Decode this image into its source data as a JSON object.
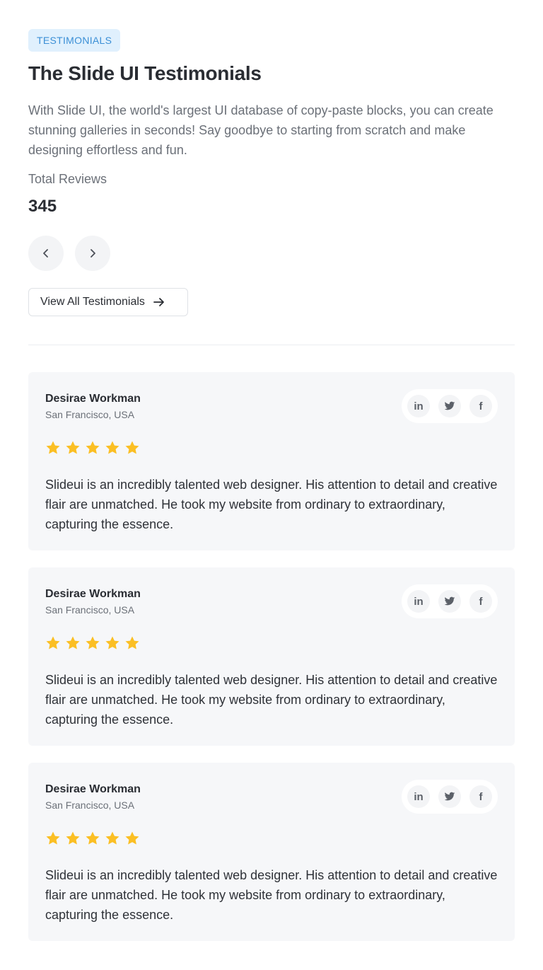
{
  "header": {
    "badge": "TESTIMONIALS",
    "title": "The Slide UI Testimonials",
    "description": "With Slide UI, the world's largest UI database of copy-paste blocks, you can create stunning galleries in seconds! Say goodbye to starting from scratch and make designing effortless and fun.",
    "reviews_label": "Total Reviews",
    "reviews_count": "345",
    "view_all_label": "View All Testimonials"
  },
  "icons": {
    "prev": "chevron-left-icon",
    "next": "chevron-right-icon",
    "view_all": "arrow-right-icon",
    "socials": [
      "linkedin-icon",
      "twitter-icon",
      "facebook-icon"
    ],
    "star": "star-icon"
  },
  "social_labels": {
    "linkedin": "in",
    "facebook": "f"
  },
  "colors": {
    "accent": "#3b8fd6",
    "badge_bg": "#e0f0fd",
    "star": "#fbbf24",
    "card_bg": "#f6f7f9"
  },
  "testimonials": [
    {
      "name": "Desirae Workman",
      "location": "San Francisco, USA",
      "rating": 5,
      "text": "Slideui is an incredibly talented web designer. His attention to detail and creative flair are unmatched. He took my website from ordinary to extraordinary, capturing the essence."
    },
    {
      "name": "Desirae Workman",
      "location": "San Francisco, USA",
      "rating": 5,
      "text": "Slideui is an incredibly talented web designer. His attention to detail and creative flair are unmatched. He took my website from ordinary to extraordinary, capturing the essence."
    },
    {
      "name": "Desirae Workman",
      "location": "San Francisco, USA",
      "rating": 5,
      "text": "Slideui is an incredibly talented web designer. His attention to detail and creative flair are unmatched. He took my website from ordinary to extraordinary, capturing the essence."
    }
  ]
}
